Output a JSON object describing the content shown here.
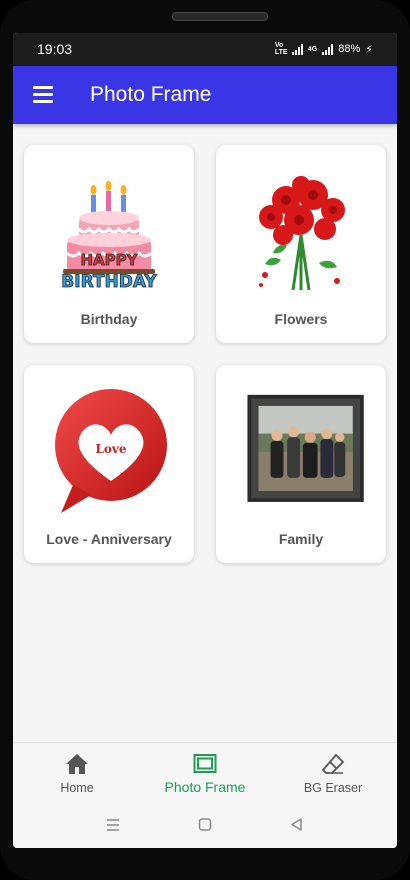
{
  "status": {
    "time": "19:03",
    "network": "4G",
    "volte": "Vo LTE",
    "battery": "88%"
  },
  "appbar": {
    "title": "Photo Frame",
    "menu_icon": "hamburger-menu-icon"
  },
  "categories": [
    {
      "label": "Birthday",
      "image": "birthday-cake-image"
    },
    {
      "label": "Flowers",
      "image": "red-roses-image"
    },
    {
      "label": "Love - Anniversary",
      "image": "love-heart-bubble-image"
    },
    {
      "label": "Family",
      "image": "family-photo-frame-image"
    }
  ],
  "bottom_nav": {
    "items": [
      {
        "label": "Home",
        "icon": "home-icon",
        "active": false
      },
      {
        "label": "Photo Frame",
        "icon": "photo-frame-icon",
        "active": true
      },
      {
        "label": "BG Eraser",
        "icon": "eraser-icon",
        "active": false
      }
    ]
  },
  "colors": {
    "appbar": "#3a36e6",
    "active_nav": "#1aa152",
    "label": "#555555"
  },
  "heart_text": "Love",
  "cake_text": [
    "HAPPY",
    "BIRTHDAY"
  ]
}
